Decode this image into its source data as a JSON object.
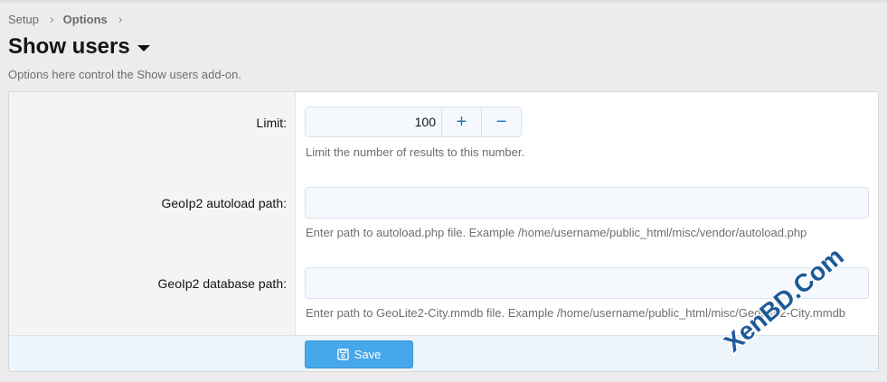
{
  "breadcrumb": {
    "items": [
      "Setup",
      "Options"
    ]
  },
  "page": {
    "title": "Show users",
    "description": "Options here control the Show users add-on."
  },
  "form": {
    "limit": {
      "label": "Limit:",
      "value": "100",
      "plus": "+",
      "minus": "−",
      "hint": "Limit the number of results to this number."
    },
    "autoload": {
      "label": "GeoIp2 autoload path:",
      "value": "",
      "hint": "Enter path to autoload.php file. Example /home/username/public_html/misc/vendor/autoload.php"
    },
    "database": {
      "label": "GeoIp2 database path:",
      "value": "",
      "hint": "Enter path to GeoLite2-City.mmdb file. Example /home/username/public_html/misc/GeoLite2-City.mmdb"
    }
  },
  "footer": {
    "save_label": "Save"
  },
  "watermark": {
    "text": "XenBD.Com"
  },
  "colors": {
    "accent": "#47a7eb",
    "link": "#2577b1",
    "watermark": "#1e5a99"
  }
}
